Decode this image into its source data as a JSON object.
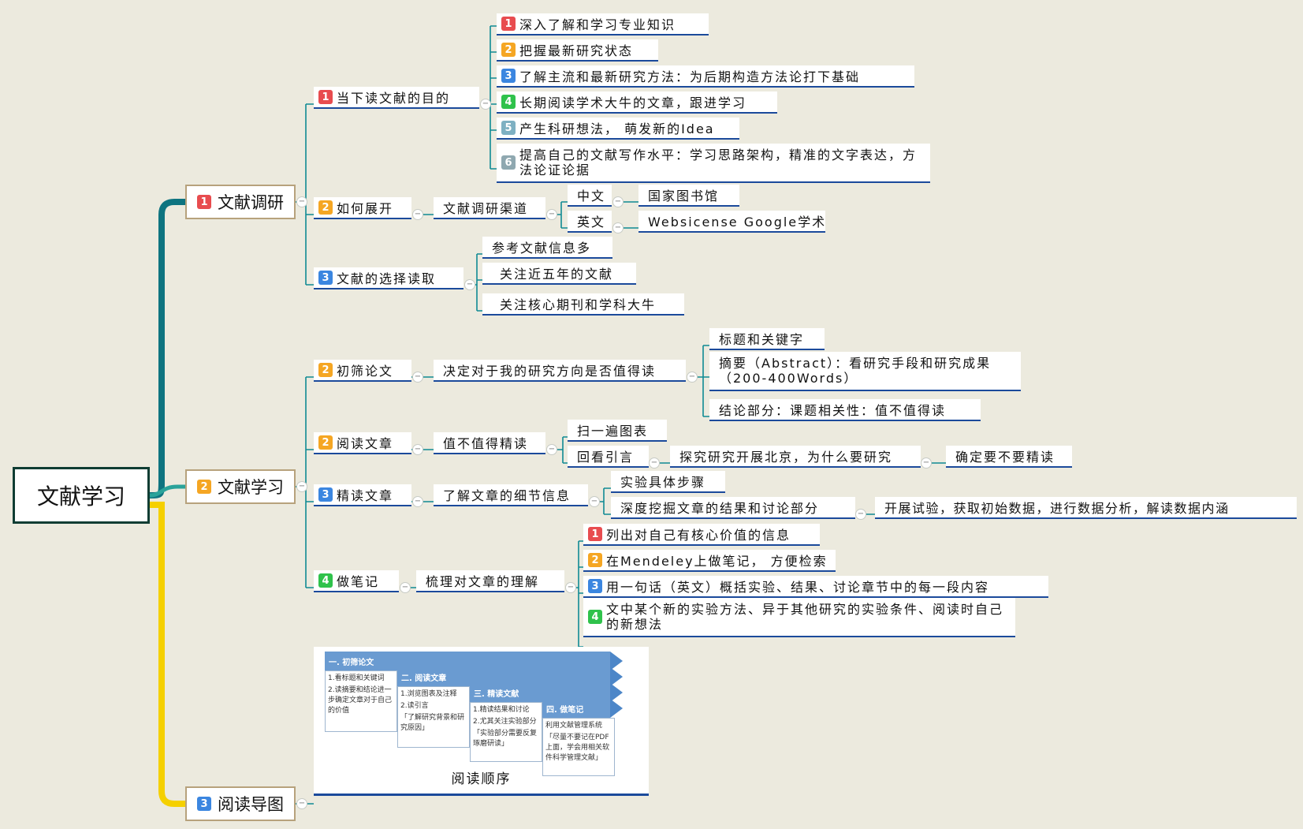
{
  "root": "文献学习",
  "branches": {
    "b1": {
      "badge": "1",
      "label": "文献调研"
    },
    "b2": {
      "badge": "2",
      "label": "文献学习"
    },
    "b3": {
      "badge": "3",
      "label": "阅读导图"
    }
  },
  "survey": {
    "purpose": {
      "badge": "1",
      "label": "当下读文献的目的",
      "items": [
        {
          "badge": "1",
          "text": "深入了解和学习专业知识"
        },
        {
          "badge": "2",
          "text": "把握最新研究状态"
        },
        {
          "badge": "3",
          "text": "了解主流和最新研究方法：为后期构造方法论打下基础"
        },
        {
          "badge": "4",
          "text": "长期阅读学术大牛的文章，跟进学习"
        },
        {
          "badge": "5",
          "text": "产生科研想法， 萌发新的Idea"
        },
        {
          "badge": "6",
          "text": "提高自己的文献写作水平：学习思路架构，精准的文字表达，方法论证论据"
        }
      ]
    },
    "how": {
      "badge": "2",
      "label": "如何展开",
      "channel": "文献调研渠道",
      "cn": "中文",
      "cn_src": "国家图书馆",
      "en": "英文",
      "en_src": "Websicense Google学术"
    },
    "select": {
      "badge": "3",
      "label": "文献的选择读取",
      "items": [
        "参考文献信息多",
        "关注近五年的文献",
        "关注核心期刊和学科大牛"
      ]
    }
  },
  "study": {
    "screen": {
      "badge": "2",
      "label": "初筛论文",
      "decide": "决定对于我的研究方向是否值得读",
      "items": [
        "标题和关键字",
        "摘要（Abstract）：看研究手段和研究成果（200-400Words）",
        "结论部分：课题相关性：值不值得读"
      ]
    },
    "read": {
      "badge": "2",
      "label": "阅读文章",
      "worth": "值不值得精读",
      "scan": "扫一遍图表",
      "refs": "回看引言",
      "bg": "探究研究开展北京，为什么要研究",
      "decide": "确定要不要精读"
    },
    "intensive": {
      "badge": "3",
      "label": "精读文章",
      "detail": "了解文章的细节信息",
      "steps": "实验具体步骤",
      "dig": "深度挖掘文章的结果和讨论部分",
      "data": "开展试验，获取初始数据，进行数据分析，解读数据内涵"
    },
    "notes": {
      "badge": "4",
      "label": "做笔记",
      "sort": "梳理对文章的理解",
      "items": [
        {
          "badge": "1",
          "text": "列出对自己有核心价值的信息"
        },
        {
          "badge": "2",
          "text": "在Mendeley上做笔记， 方便检索"
        },
        {
          "badge": "3",
          "text": "用一句话（英文）概括实验、结果、讨论章节中的每一段内容"
        },
        {
          "badge": "4",
          "text": "文中某个新的实验方法、异于其他研究的实验条件、阅读时自己的新想法"
        }
      ]
    }
  },
  "guide": {
    "caption": "阅读顺序",
    "steps": [
      {
        "title": "一. 初筛论文",
        "lines": [
          "1.看标题和关键词",
          "2.读摘要和结论进一步确定文章对于自己的价值"
        ]
      },
      {
        "title": "二. 阅读文章",
        "lines": [
          "1.浏览图表及注释",
          "2.读引言",
          "「了解研究背景和研究原因」"
        ]
      },
      {
        "title": "三. 精读文献",
        "lines": [
          "1.精读结果和讨论",
          "2.尤其关注实验部分",
          "「实验部分需要反复琢磨研读」"
        ]
      },
      {
        "title": "四. 做笔记",
        "lines": [
          "利用文献管理系统",
          "「尽量不要记在PDF上面，学会用相关软件科学管理文献」"
        ]
      }
    ]
  },
  "colors": {
    "teal": "#0e7480",
    "yellow": "#f5d000",
    "line": "#0f8a94",
    "underline": "#1b4a9b",
    "bg": "#eceade"
  }
}
